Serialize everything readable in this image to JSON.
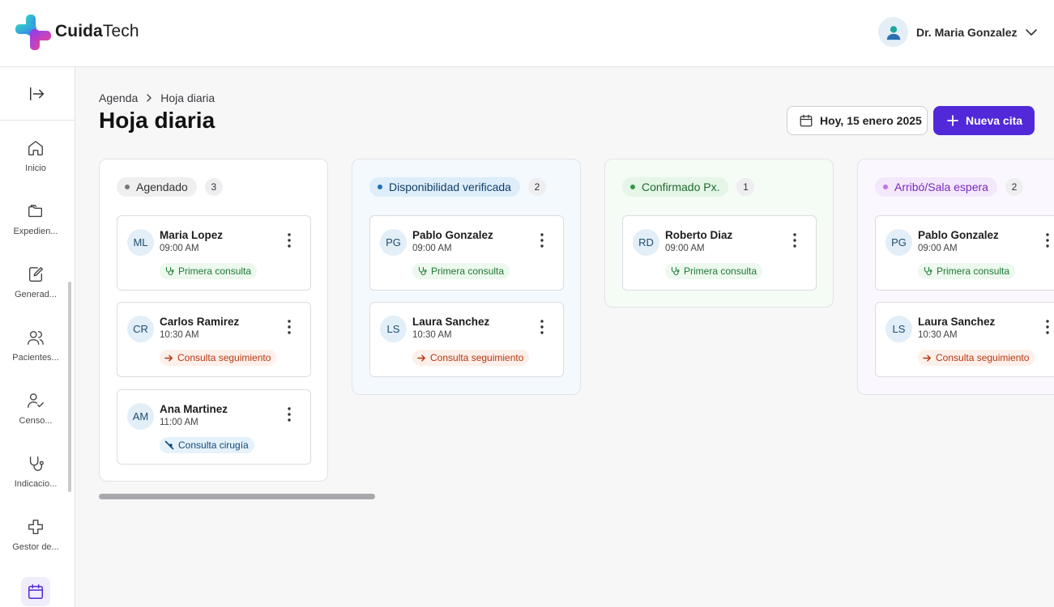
{
  "app": {
    "brand_bold": "Cuida",
    "brand_rest": "Tech"
  },
  "user": {
    "name": "Dr. Maria Gonzalez"
  },
  "sidebar": {
    "items": [
      {
        "label": "Inicio",
        "icon": "home-icon"
      },
      {
        "label": "Expedien...",
        "icon": "folder-icon"
      },
      {
        "label": "Generad...",
        "icon": "document-edit-icon"
      },
      {
        "label": "Pacientes...",
        "icon": "users-icon"
      },
      {
        "label": "Censo...",
        "icon": "user-check-icon"
      },
      {
        "label": "Indicacio...",
        "icon": "stethoscope-icon"
      },
      {
        "label": "Gestor de...",
        "icon": "plus-icon"
      },
      {
        "label": "",
        "icon": "calendar-icon",
        "active": true
      }
    ]
  },
  "breadcrumb": {
    "parent": "Agenda",
    "current": "Hoja diaria"
  },
  "page": {
    "title": "Hoja diaria"
  },
  "toolbar": {
    "date_label": "Hoy, 15 enero 2025",
    "new_label": "Nueva cita"
  },
  "colors": {
    "accent": "#5229d8"
  },
  "columns": [
    {
      "status": "Agendado",
      "count": "3",
      "cards": [
        {
          "initials": "ML",
          "name": "Maria Lopez",
          "time": "09:00 AM",
          "tag": "Primera consulta",
          "tag_type": "green"
        },
        {
          "initials": "CR",
          "name": "Carlos Ramirez",
          "time": "10:30 AM",
          "tag": "Consulta seguimiento",
          "tag_type": "orange"
        },
        {
          "initials": "AM",
          "name": "Ana Martinez",
          "time": "11:00 AM",
          "tag": "Consulta cirugía",
          "tag_type": "blue"
        }
      ]
    },
    {
      "status": "Disponibilidad verificada",
      "count": "2",
      "cards": [
        {
          "initials": "PG",
          "name": "Pablo Gonzalez",
          "time": "09:00 AM",
          "tag": "Primera consulta",
          "tag_type": "green"
        },
        {
          "initials": "LS",
          "name": "Laura Sanchez",
          "time": "10:30 AM",
          "tag": "Consulta seguimiento",
          "tag_type": "orange"
        }
      ]
    },
    {
      "status": "Confirmado Px.",
      "count": "1",
      "cards": [
        {
          "initials": "RD",
          "name": "Roberto Diaz",
          "time": "09:00 AM",
          "tag": "Primera consulta",
          "tag_type": "green"
        }
      ]
    },
    {
      "status": "Arribó/Sala espera",
      "count": "2",
      "cards": [
        {
          "initials": "PG",
          "name": "Pablo Gonzalez",
          "time": "09:00 AM",
          "tag": "Primera consulta",
          "tag_type": "green"
        },
        {
          "initials": "LS",
          "name": "Laura Sanchez",
          "time": "10:30 AM",
          "tag": "Consulta seguimiento",
          "tag_type": "orange"
        }
      ]
    }
  ]
}
